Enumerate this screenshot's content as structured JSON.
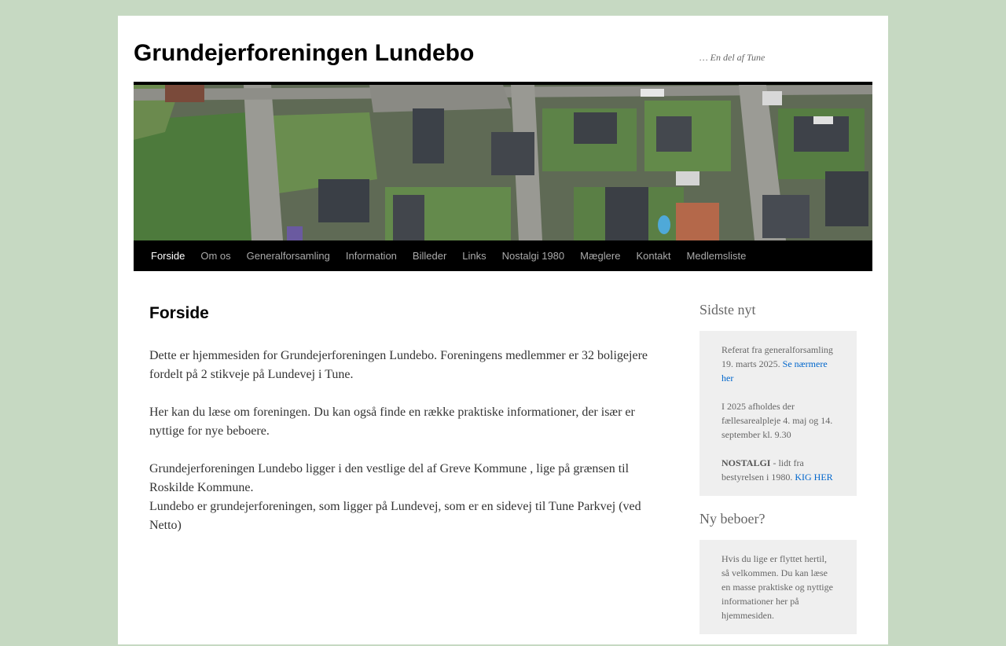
{
  "site": {
    "title": "Grundejerforeningen Lundebo",
    "description": "… En del af Tune"
  },
  "nav": {
    "items": [
      {
        "label": "Forside",
        "current": true
      },
      {
        "label": "Om os"
      },
      {
        "label": "Generalforsamling"
      },
      {
        "label": "Information"
      },
      {
        "label": "Billeder"
      },
      {
        "label": "Links"
      },
      {
        "label": "Nostalgi 1980"
      },
      {
        "label": "Mæglere"
      },
      {
        "label": "Kontakt"
      },
      {
        "label": "Medlemsliste"
      }
    ]
  },
  "page": {
    "title": "Forside",
    "paragraphs": [
      "Dette er hjemmesiden for Grundejerforeningen Lundebo. Foreningens medlemmer er 32 boligejere fordelt på 2 stikveje på Lundevej i Tune.",
      "Her kan du læse om foreningen. Du kan også finde en række praktiske informationer, der især er nyttige for nye beboere.",
      "Grundejerforeningen Lundebo ligger i den vestlige del af Greve Kommune , lige på grænsen til Roskilde Kommune.",
      "Lundebo er grundejerforeningen, som ligger på Lundevej, som er en sidevej til Tune Parkvej (ved Netto)"
    ]
  },
  "sidebar": {
    "news": {
      "title": "Sidste nyt",
      "item1_text": "Referat fra generalforsamling 19. marts 2025. ",
      "item1_link": "Se nærmere her",
      "item2_text": "I 2025 afholdes der fællesarealpleje 4. maj og 14. september kl. 9.30",
      "item3_bold": "NOSTALGI",
      "item3_text": " - lidt fra bestyrelsen i 1980. ",
      "item3_link": "KIG HER"
    },
    "newcomer": {
      "title": "Ny beboer?",
      "text": "Hvis du lige er flyttet hertil, så velkommen. Du kan læse en masse praktiske og nyttige informationer her på hjemmesiden."
    }
  }
}
